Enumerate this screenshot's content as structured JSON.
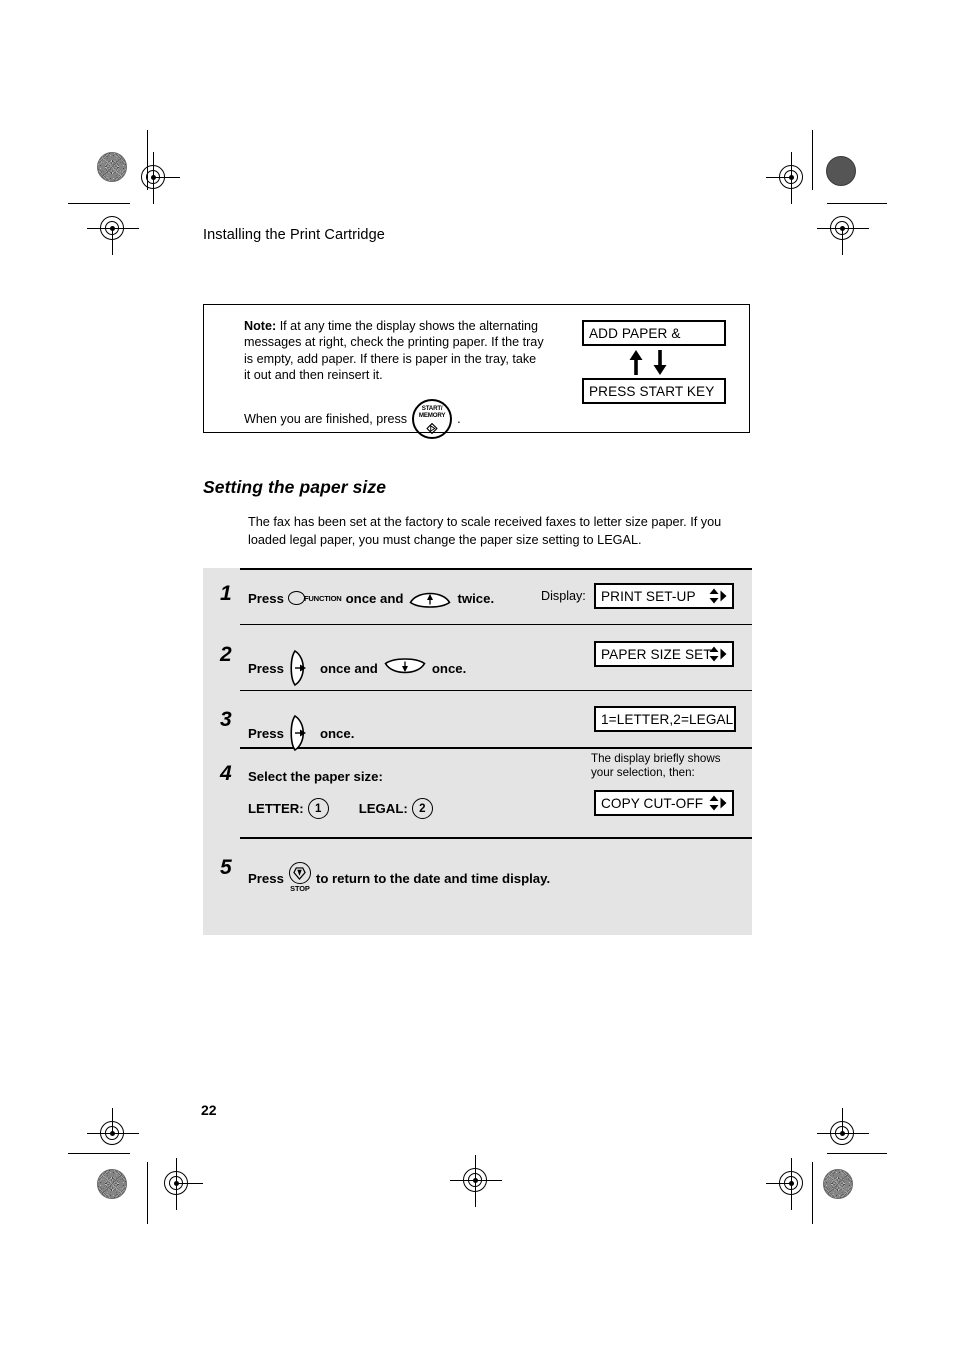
{
  "page": {
    "header": "Installing the Print Cartridge",
    "number": "22"
  },
  "note": {
    "label": "Note:",
    "body": "If at any time the display shows the alternating messages at right, check the printing paper. If the tray is empty, add paper. If there is paper in the tray, take it out and then reinsert it.",
    "finish_prefix": "When you are finished, press",
    "finish_suffix": ".",
    "start_key": {
      "line1": "START/",
      "line2": "MEMORY",
      "icon": "diamond-play-icon"
    },
    "displays": {
      "top": "ADD PAPER &",
      "bottom": "PRESS START KEY"
    },
    "alternating_icon": "up-down-alternating-arrows-icon"
  },
  "section": {
    "heading": "Setting the paper size",
    "intro": "The fax has been set at the factory to scale received faxes to letter size paper. If you loaded legal paper, you must change the paper size setting to LEGAL."
  },
  "steps": [
    {
      "num": "1",
      "press_label": "Press",
      "function_key": "FUNCTION",
      "mid_text": "once and",
      "end_text": "twice.",
      "display_label": "Display:",
      "display_value": "PRINT SET-UP",
      "has_scroll_arrows": true
    },
    {
      "num": "2",
      "press_label": "Press",
      "mid_text": "once and",
      "end_text": "once.",
      "display_value": "PAPER SIZE SET",
      "has_scroll_arrows": true
    },
    {
      "num": "3",
      "press_label": "Press",
      "end_text": "once.",
      "display_value": "1=LETTER,2=LEGAL",
      "has_scroll_arrows": false
    },
    {
      "num": "4",
      "prompt": "Select the paper size:",
      "letter_label": "LETTER:",
      "letter_key": "1",
      "legal_label": "LEGAL:",
      "legal_key": "2",
      "side_note": "The display briefly shows your selection, then:",
      "display_value": "COPY CUT-OFF",
      "has_scroll_arrows": true
    },
    {
      "num": "5",
      "press_label": "Press",
      "stop_key": "STOP",
      "end_text": "to return to the date and time display."
    }
  ],
  "colors": {
    "steps_background": "#e4e4e4",
    "ink": "#000000",
    "paper": "#ffffff"
  }
}
